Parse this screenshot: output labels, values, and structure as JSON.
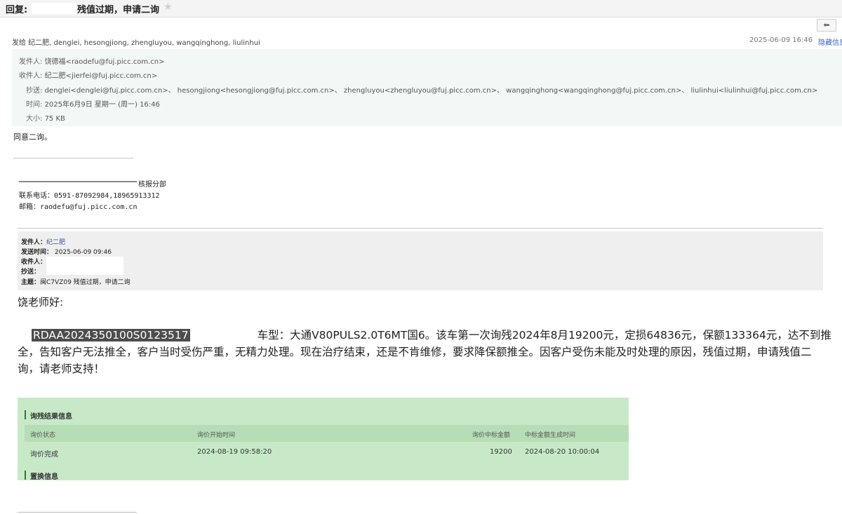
{
  "window": {
    "title_prefix": "回复: ",
    "title_suffix": "残值过期，申请二询"
  },
  "toolbar": {
    "reply_icon": "reply-arrow-icon"
  },
  "summary": {
    "sendto": "发给 纪二肥, denglei, hesongjiong, zhengluyou, wangqinghong, liulinhui",
    "date": "2025-06-09 16:46",
    "hide_link": "隐藏信息"
  },
  "headers": {
    "from_label": "发件人:",
    "from_value": "饶德福<raodefu@fuj.picc.com.cn>",
    "to_label": "收件人:",
    "to_value": "纪二肥<jierfei@fuj.picc.com.cn>",
    "cc_label": "抄送:",
    "cc_value": "denglei<denglei@fuj.picc.com.cn>、 hesongjiong<hesongjiong@fuj.picc.com.cn>、 zhengluyou<zhengluyou@fuj.picc.com.cn>、 wangqinghong<wangqinghong@fuj.picc.com.cn>、 liulinhui<liulinhui@fuj.picc.com.cn>",
    "time_label": "时间:",
    "time_value": "2025年6月9日 星期一 (周一) 16:46",
    "size_label": "大小:",
    "size_value": "75 KB"
  },
  "reply_body": "同意二询。",
  "signature": {
    "dept": "核报分部",
    "phone": "联系电话：0591-87092984,18965913312",
    "email": "邮箱：raodefu@fuj.picc.com.cn"
  },
  "quoted": {
    "from_label": "发件人：",
    "from_value": "纪二肥",
    "sent_label": "发送时间：",
    "sent_value": "2025-06-09 09:46",
    "to_label": "收件人：",
    "cc_label": "抄送：",
    "subject_label": "主题：",
    "subject_value": "闽C7VZ09 残值过期，申请二询"
  },
  "letter": {
    "greeting": "饶老师好:",
    "claim_no": "RDAA2024350100S0123517",
    "text": "车型：大通V80PULS2.0T6MT国6。该车第一次询残2024年8月19200元，定损64836元，保额133364元，达不到推全，告知客户无法推全，客户当时受伤严重，无精力处理。现在治疗结束，还是不肯维修，要求降保额推全。因客户受伤未能及时处理的原因，残值过期，申请残值二询，请老师支持！"
  },
  "inquiry_panel": {
    "section1": "询残结果信息",
    "headers": [
      "询价状态",
      "询价开始时间",
      "询价中标金额",
      "中标金额生成时间"
    ],
    "row": [
      "询价完成",
      "2024-08-19 09:58:20",
      "19200",
      "2024-08-20 10:00:04"
    ],
    "section2": "置换信息"
  },
  "colors": {
    "panel_bg": "#c8e9c8",
    "link": "#3366cc",
    "claim_highlight": "#4d4d4d"
  }
}
